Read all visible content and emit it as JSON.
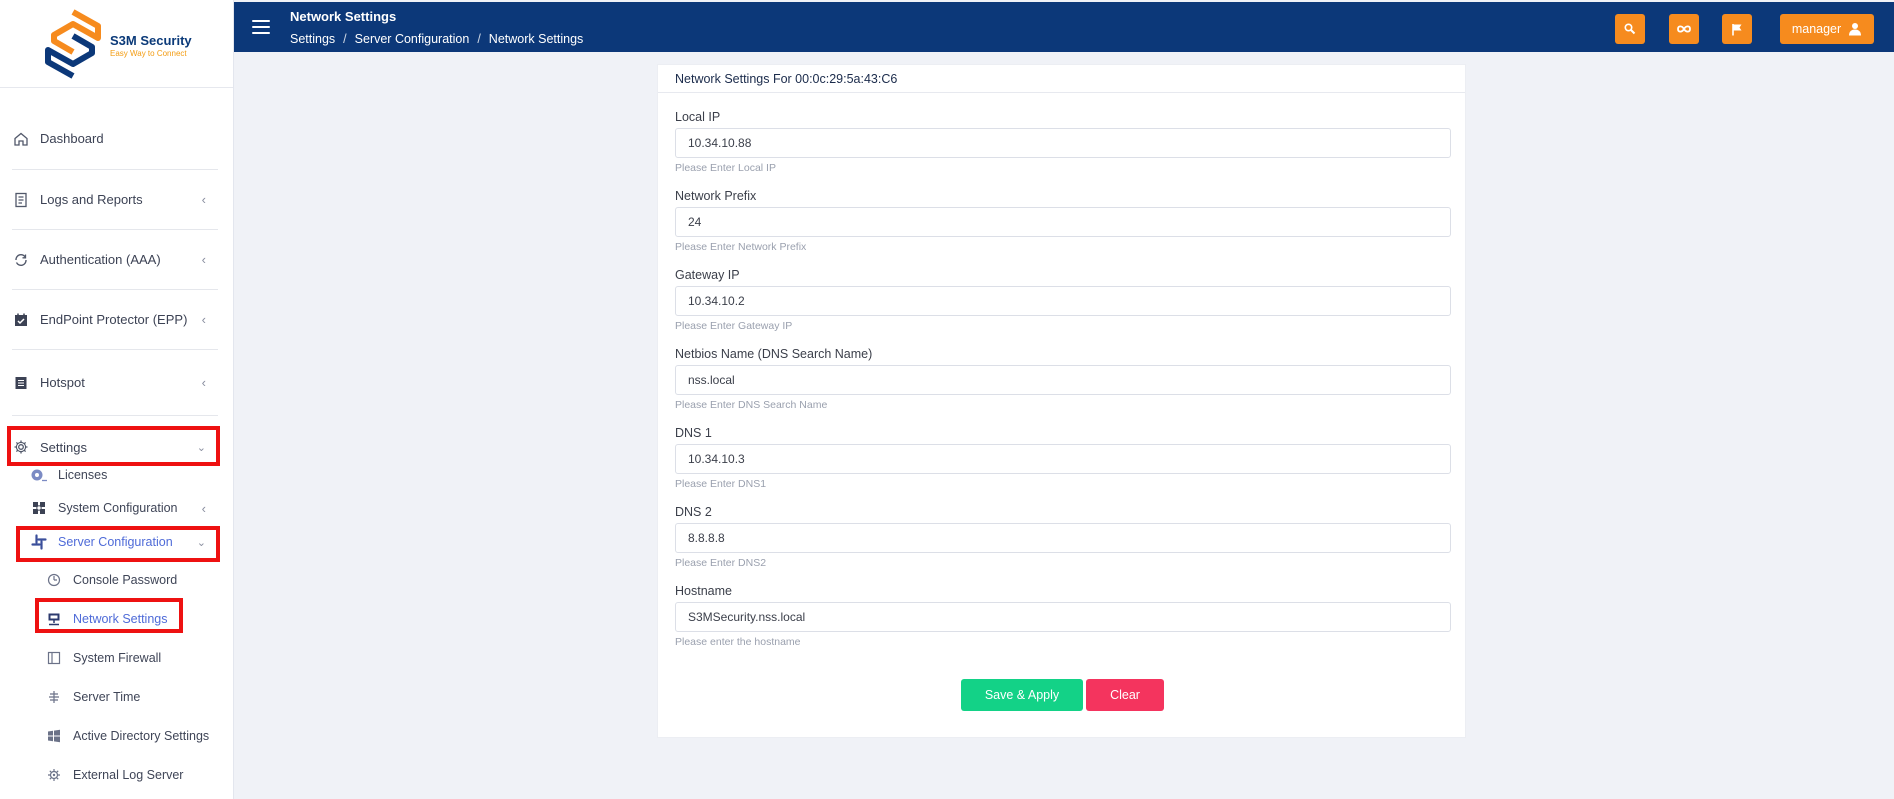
{
  "brand": {
    "name": "S3M Security",
    "tagline": "Easy Way to Connect"
  },
  "header": {
    "title": "Network Settings",
    "breadcrumb": [
      "Settings",
      "Server Configuration",
      "Network Settings"
    ],
    "user_label": "manager"
  },
  "sidebar": {
    "items": [
      {
        "label": "Dashboard"
      },
      {
        "label": "Logs and Reports"
      },
      {
        "label": "Authentication (AAA)"
      },
      {
        "label": "EndPoint Protector (EPP)"
      },
      {
        "label": "Hotspot"
      },
      {
        "label": "Settings"
      }
    ],
    "settings_sub": [
      {
        "label": "Licenses"
      },
      {
        "label": "System Configuration"
      },
      {
        "label": "Server Configuration"
      }
    ],
    "server_config_sub": [
      {
        "label": "Console Password"
      },
      {
        "label": "Network Settings"
      },
      {
        "label": "System Firewall"
      },
      {
        "label": "Server Time"
      },
      {
        "label": "Active Directory Settings"
      },
      {
        "label": "External Log Server"
      }
    ]
  },
  "form": {
    "title": "Network Settings For 00:0c:29:5a:43:C6",
    "fields": [
      {
        "label": "Local IP",
        "value": "10.34.10.88",
        "help": "Please Enter Local IP"
      },
      {
        "label": "Network Prefix",
        "value": "24",
        "help": "Please Enter Network Prefix"
      },
      {
        "label": "Gateway IP",
        "value": "10.34.10.2",
        "help": "Please Enter Gateway IP"
      },
      {
        "label": "Netbios Name (DNS Search Name)",
        "value": "nss.local",
        "help": "Please Enter DNS Search Name"
      },
      {
        "label": "DNS 1",
        "value": "10.34.10.3",
        "help": "Please Enter DNS1"
      },
      {
        "label": "DNS 2",
        "value": "8.8.8.8",
        "help": "Please Enter DNS2"
      },
      {
        "label": "Hostname",
        "value": "S3MSecurity.nss.local",
        "help": "Please enter the hostname"
      }
    ],
    "save_label": "Save & Apply",
    "clear_label": "Clear"
  },
  "colors": {
    "topbar": "#0c3879",
    "accent_orange": "#f68b1e",
    "save": "#13d287",
    "clear": "#f4345e",
    "active_link": "#4f6bd8",
    "highlight": "#ee1111"
  }
}
